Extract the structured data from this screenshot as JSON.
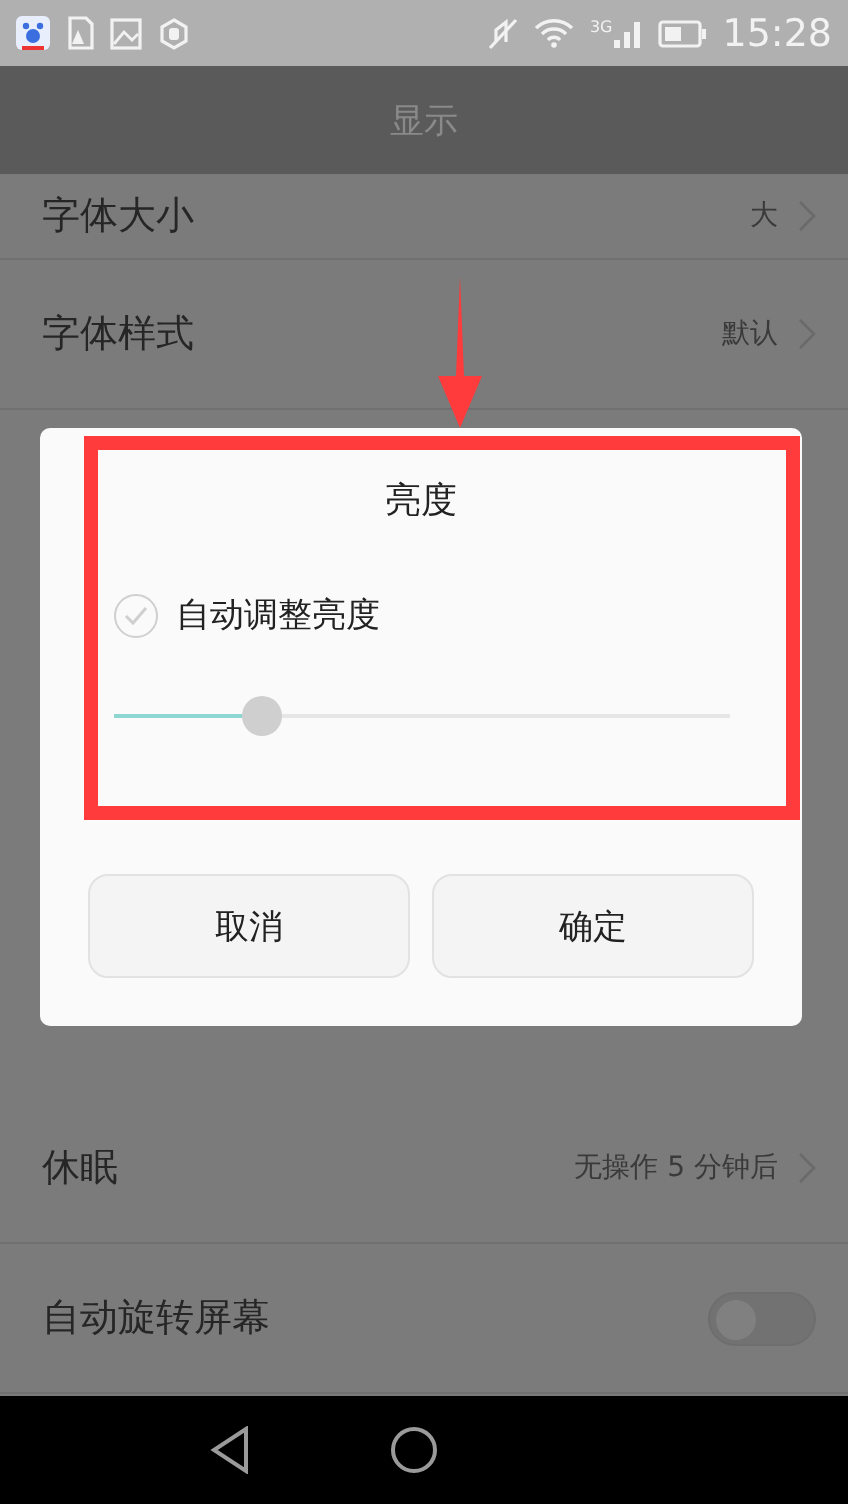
{
  "status_bar": {
    "network": "3G",
    "time": "15:28"
  },
  "app_bar": {
    "title": "显示"
  },
  "settings_top": [
    {
      "label": "字体大小",
      "value": "大",
      "kind": "link"
    },
    {
      "label": "字体样式",
      "value": "默认",
      "kind": "link"
    }
  ],
  "settings_bottom": [
    {
      "label": "休眠",
      "value": "无操作 5 分钟后",
      "kind": "link"
    },
    {
      "label": "自动旋转屏幕",
      "kind": "switch",
      "on": false
    }
  ],
  "dialog": {
    "title": "亮度",
    "auto_brightness": {
      "label": "自动调整亮度",
      "checked": false
    },
    "slider": {
      "level": 0.24
    },
    "buttons": [
      {
        "label": "取消"
      },
      {
        "label": "确定"
      }
    ]
  }
}
